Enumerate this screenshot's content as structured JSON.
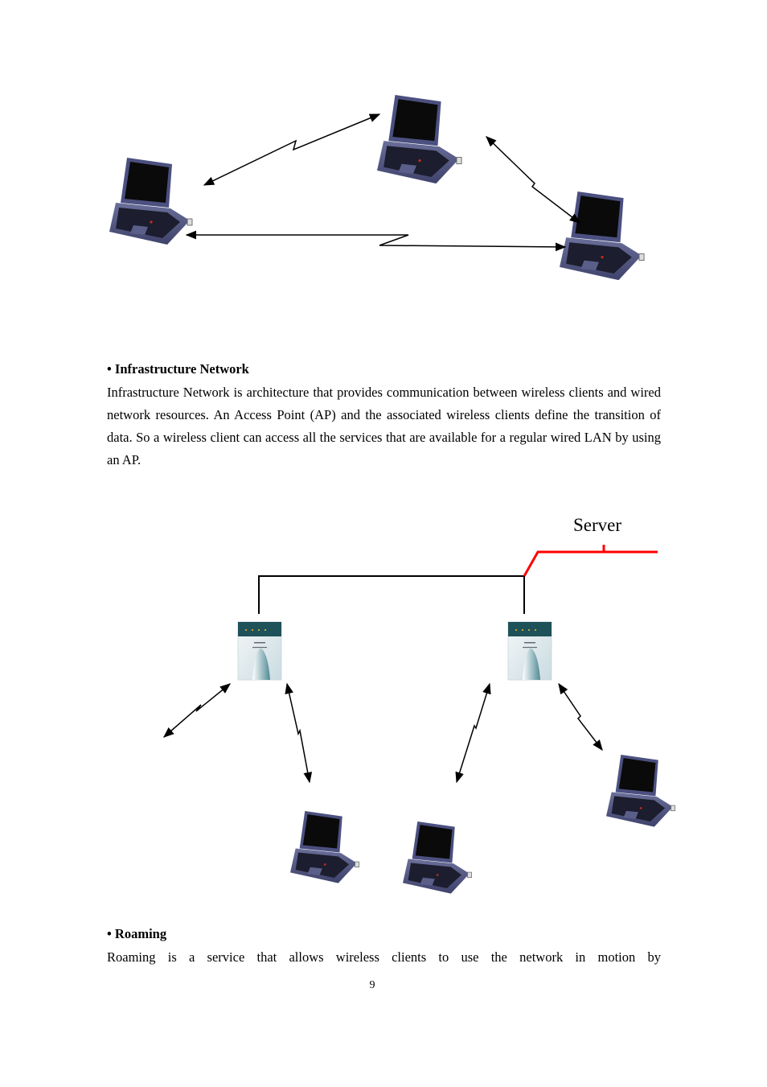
{
  "diagram_adhoc": {
    "nodes": [
      {
        "id": "laptop-left",
        "kind": "laptop"
      },
      {
        "id": "laptop-top",
        "kind": "laptop"
      },
      {
        "id": "laptop-right",
        "kind": "laptop"
      }
    ],
    "links": [
      {
        "from": "laptop-left",
        "to": "laptop-top",
        "type": "wireless"
      },
      {
        "from": "laptop-top",
        "to": "laptop-right",
        "type": "wireless"
      },
      {
        "from": "laptop-left",
        "to": "laptop-right",
        "type": "wireless"
      }
    ]
  },
  "section_infrastructure": {
    "bullet": "•",
    "title": "Infrastructure Network",
    "body": "Infrastructure Network is architecture that provides communication between wireless clients and wired network resources. An Access Point (AP) and the associated wireless clients define the transition of data. So a wireless client can access all the services that are available for a regular wired LAN by using an AP."
  },
  "diagram_infrastructure": {
    "server_label": "Server",
    "wired_color": "#000000",
    "server_line_color": "#ff0000",
    "nodes": [
      {
        "id": "ap-left",
        "kind": "access-point"
      },
      {
        "id": "ap-right",
        "kind": "access-point"
      },
      {
        "id": "laptop-1",
        "kind": "laptop"
      },
      {
        "id": "laptop-2",
        "kind": "laptop"
      },
      {
        "id": "laptop-3",
        "kind": "laptop"
      }
    ]
  },
  "section_roaming": {
    "bullet": "•",
    "title": "Roaming",
    "body": "Roaming is a service that allows wireless clients to use the network in motion by"
  },
  "page_number": "9"
}
